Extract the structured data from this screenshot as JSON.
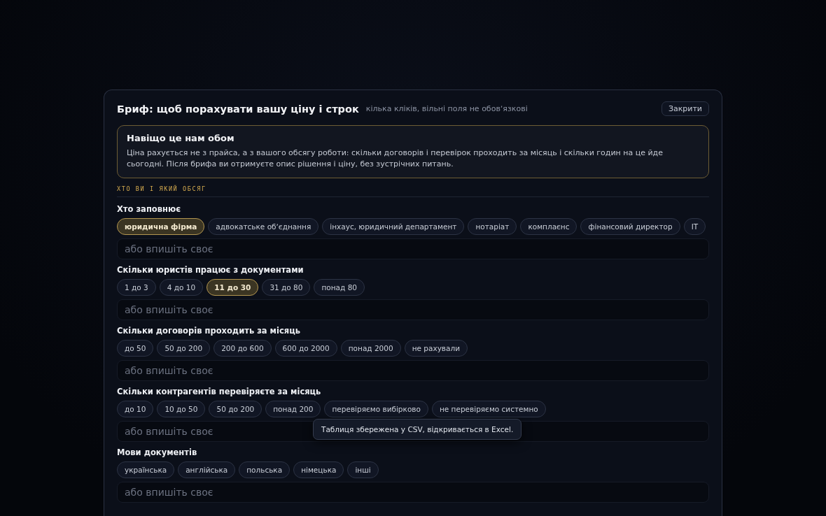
{
  "dialog": {
    "title": "Бриф: щоб порахувати вашу ціну і строк",
    "subtitle": "кілька кліків, вільні поля не обовʼязкові",
    "close_button": "Закрити"
  },
  "info": {
    "title": "Навіщо це нам обом",
    "text": "Ціна рахується не з прайса, а з вашого обсягу роботи: скільки договорів і перевірок проходить за місяць і скільки годин на це йде сьогодні. Після брифа ви отримуєте опис рішення і ціну, без зустрічних питань."
  },
  "section_label": "ХТО ВИ І ЯКИЙ ОБСЯГ",
  "questions": [
    {
      "label": "Хто заповнює",
      "placeholder": "або впишіть своє",
      "options": [
        {
          "label": "юридична фірма",
          "selected": true
        },
        {
          "label": "адвокатське обʼєднання",
          "selected": false
        },
        {
          "label": "інхаус, юридичний департамент",
          "selected": false
        },
        {
          "label": "нотаріат",
          "selected": false
        },
        {
          "label": "комплаєнс",
          "selected": false
        },
        {
          "label": "фінансовий директор",
          "selected": false
        },
        {
          "label": "IT",
          "selected": false
        }
      ]
    },
    {
      "label": "Скільки юристів працює з документами",
      "placeholder": "або впишіть своє",
      "options": [
        {
          "label": "1 до 3",
          "selected": false
        },
        {
          "label": "4 до 10",
          "selected": false
        },
        {
          "label": "11 до 30",
          "selected": true
        },
        {
          "label": "31 до 80",
          "selected": false
        },
        {
          "label": "понад 80",
          "selected": false
        }
      ]
    },
    {
      "label": "Скільки договорів проходить за місяць",
      "placeholder": "або впишіть своє",
      "options": [
        {
          "label": "до 50",
          "selected": false
        },
        {
          "label": "50 до 200",
          "selected": false
        },
        {
          "label": "200 до 600",
          "selected": false
        },
        {
          "label": "600 до 2000",
          "selected": false
        },
        {
          "label": "понад 2000",
          "selected": false
        },
        {
          "label": "не рахували",
          "selected": false
        }
      ]
    },
    {
      "label": "Скільки контрагентів перевіряєте за місяць",
      "placeholder": "або впишіть своє",
      "tooltip": "Таблиця збережена у CSV, відкривається в Excel.",
      "options": [
        {
          "label": "до 10",
          "selected": false
        },
        {
          "label": "10 до 50",
          "selected": false
        },
        {
          "label": "50 до 200",
          "selected": false
        },
        {
          "label": "понад 200",
          "selected": false
        },
        {
          "label": "перевіряємо вибірково",
          "selected": false
        },
        {
          "label": "не перевіряємо системно",
          "selected": false
        }
      ]
    },
    {
      "label": "Мови документів",
      "placeholder": "або впишіть своє",
      "options": [
        {
          "label": "українська",
          "selected": false
        },
        {
          "label": "англійська",
          "selected": false
        },
        {
          "label": "польська",
          "selected": false
        },
        {
          "label": "німецька",
          "selected": false
        },
        {
          "label": "інші",
          "selected": false
        }
      ]
    }
  ]
}
